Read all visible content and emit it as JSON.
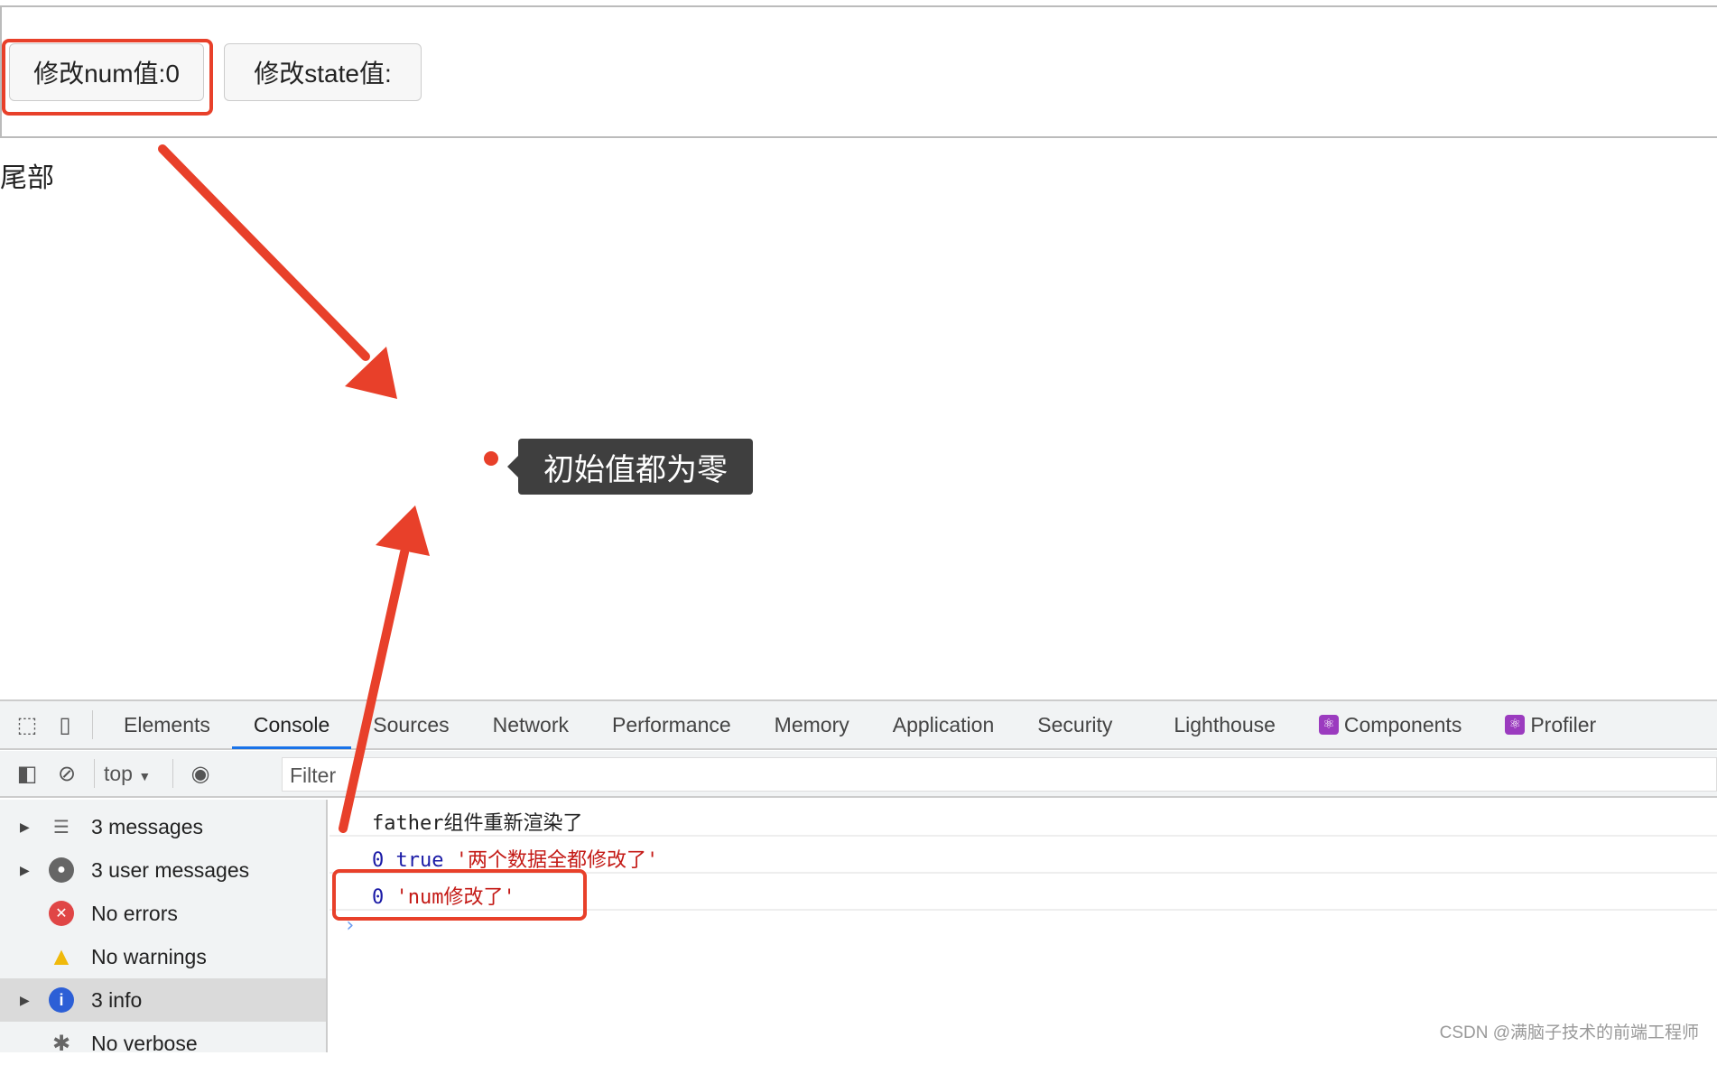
{
  "page": {
    "buttons": [
      {
        "label": "修改num值:0"
      },
      {
        "label": "修改state值:"
      }
    ],
    "footer": "尾部"
  },
  "annotation": {
    "tooltip": "初始值都为零",
    "color": "#e8402a"
  },
  "devtools": {
    "tabs": [
      {
        "label": "Elements"
      },
      {
        "label": "Console",
        "active": true
      },
      {
        "label": "Sources"
      },
      {
        "label": "Network"
      },
      {
        "label": "Performance"
      },
      {
        "label": "Memory"
      },
      {
        "label": "Application"
      },
      {
        "label": "Security"
      },
      {
        "label": "Lighthouse"
      },
      {
        "label": "Components",
        "icon": "react-icon"
      },
      {
        "label": "Profiler",
        "icon": "react-icon"
      }
    ],
    "toolbar": {
      "context": "top",
      "filter_placeholder": "Filter"
    },
    "sidebar": [
      {
        "label": "3 messages",
        "icon": "list-icon"
      },
      {
        "label": "3 user messages",
        "icon": "user-icon"
      },
      {
        "label": "No errors",
        "icon": "error-icon"
      },
      {
        "label": "No warnings",
        "icon": "warning-icon"
      },
      {
        "label": "3 info",
        "icon": "info-icon",
        "selected": true
      },
      {
        "label": "No verbose",
        "icon": "bug-icon"
      }
    ],
    "console": {
      "line1": "father组件重新渲染了",
      "line2": {
        "num": "0",
        "bool": "true",
        "str": "'两个数据全都修改了'"
      },
      "line3": {
        "num": "0",
        "str": "'num修改了'"
      }
    }
  },
  "watermark": "CSDN @满脑子技术的前端工程师"
}
